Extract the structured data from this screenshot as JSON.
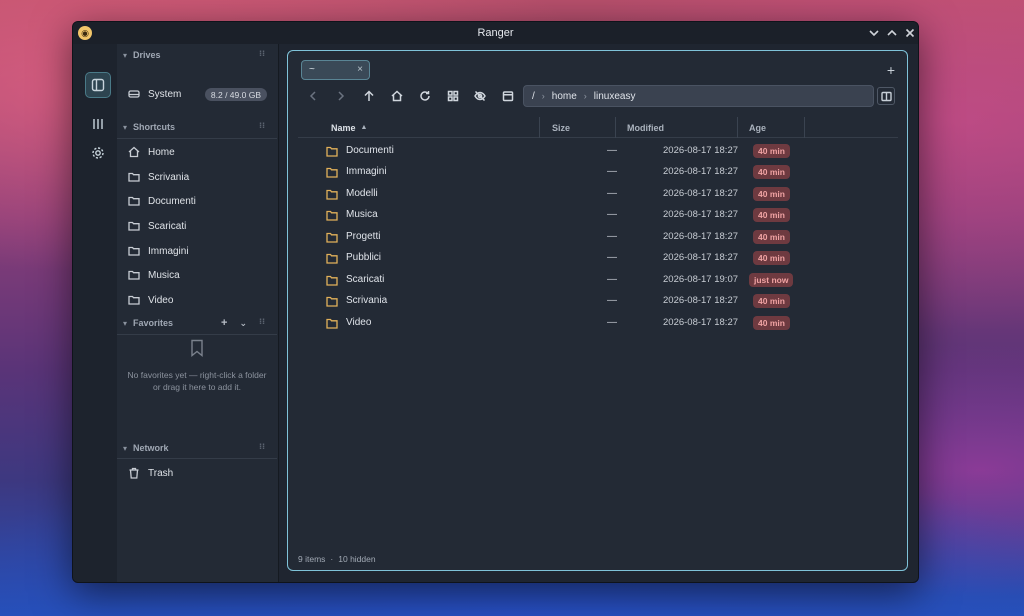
{
  "window": {
    "title": "Ranger",
    "logo_glyph": "◉"
  },
  "sidebar": {
    "drives_header": "Drives",
    "drives": [
      {
        "label": "System",
        "usage": "8.2 / 49.0 GB"
      }
    ],
    "shortcuts_header": "Shortcuts",
    "shortcuts": [
      {
        "label": "Home",
        "icon": "home-icon"
      },
      {
        "label": "Scrivania",
        "icon": "folder-icon"
      },
      {
        "label": "Documenti",
        "icon": "folder-icon"
      },
      {
        "label": "Scaricati",
        "icon": "folder-icon"
      },
      {
        "label": "Immagini",
        "icon": "folder-icon"
      },
      {
        "label": "Musica",
        "icon": "folder-icon"
      },
      {
        "label": "Video",
        "icon": "folder-icon"
      }
    ],
    "favorites_header": "Favorites",
    "favorites_add": "+",
    "favorites_empty": [
      "No favorites yet — right-click a folder",
      "or drag it here to add it."
    ],
    "network_header": "Network",
    "network": [
      {
        "label": "Trash",
        "icon": "trash-icon"
      }
    ]
  },
  "tabs": [
    {
      "label": "~",
      "close": "×"
    }
  ],
  "new_tab": "+",
  "path": {
    "root": "/",
    "segments": [
      "home",
      "linuxeasy"
    ],
    "separator": "›"
  },
  "columns": {
    "name": "Name",
    "size": "Size",
    "modified": "Modified",
    "age": "Age"
  },
  "files": [
    {
      "name": "Documenti",
      "size": "—",
      "modified": "2026-08-17 18:27",
      "age": "40 min"
    },
    {
      "name": "Immagini",
      "size": "—",
      "modified": "2026-08-17 18:27",
      "age": "40 min"
    },
    {
      "name": "Modelli",
      "size": "—",
      "modified": "2026-08-17 18:27",
      "age": "40 min"
    },
    {
      "name": "Musica",
      "size": "—",
      "modified": "2026-08-17 18:27",
      "age": "40 min"
    },
    {
      "name": "Progetti",
      "size": "—",
      "modified": "2026-08-17 18:27",
      "age": "40 min"
    },
    {
      "name": "Pubblici",
      "size": "—",
      "modified": "2026-08-17 18:27",
      "age": "40 min"
    },
    {
      "name": "Scaricati",
      "size": "—",
      "modified": "2026-08-17 19:07",
      "age": "just now"
    },
    {
      "name": "Scrivania",
      "size": "—",
      "modified": "2026-08-17 18:27",
      "age": "40 min"
    },
    {
      "name": "Video",
      "size": "—",
      "modified": "2026-08-17 18:27",
      "age": "40 min"
    }
  ],
  "status": {
    "items": "9 items",
    "hidden": "10 hidden",
    "separator": "·"
  },
  "colors": {
    "accent": "#7fc3d9",
    "folder": "#e2b15a",
    "badge_bg": "#6e3a40",
    "badge_text": "#f0a3a3"
  }
}
